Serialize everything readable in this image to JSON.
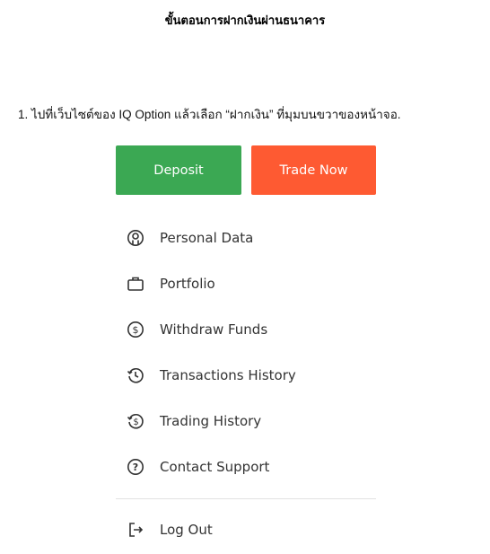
{
  "page_title": "ขั้นตอนการฝากเงินผ่านธนาคาร",
  "step_text": "1. ไปที่เว็บไซต์ของ IQ Option แล้วเลือก “ฝากเงิน” ที่มุมบนขวาของหน้าจอ.",
  "buttons": {
    "deposit_label": "Deposit",
    "trade_now_label": "Trade Now"
  },
  "menu": {
    "items": [
      {
        "label": "Personal Data",
        "icon": "personal-data-icon"
      },
      {
        "label": "Portfolio",
        "icon": "briefcase-icon"
      },
      {
        "label": "Withdraw Funds",
        "icon": "dollar-circle-icon"
      },
      {
        "label": "Transactions History",
        "icon": "history-clock-icon"
      },
      {
        "label": "Trading History",
        "icon": "history-dollar-icon"
      },
      {
        "label": "Contact Support",
        "icon": "question-circle-icon"
      }
    ],
    "logout_label": "Log Out"
  },
  "colors": {
    "deposit": "#3ba853",
    "trade_now": "#fe5a32",
    "icon": "#333333"
  }
}
